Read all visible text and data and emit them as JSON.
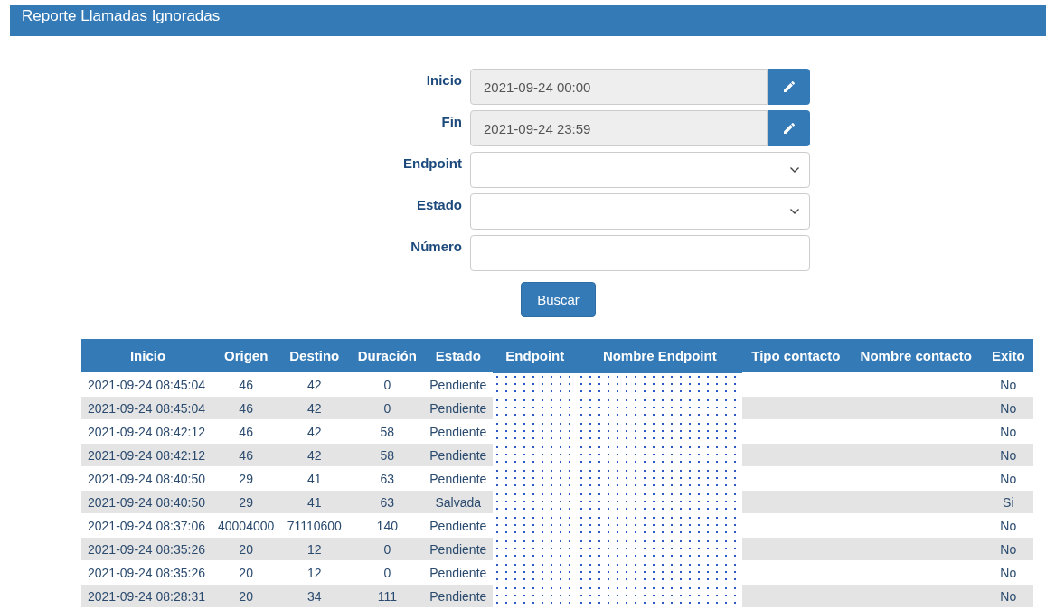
{
  "header": {
    "title": "Reporte Llamadas Ignoradas"
  },
  "form": {
    "fields": [
      {
        "label": "Inicio",
        "kind": "date",
        "value": "2021-09-24 00:00"
      },
      {
        "label": "Fin",
        "kind": "date",
        "value": "2021-09-24 23:59"
      },
      {
        "label": "Endpoint",
        "kind": "select"
      },
      {
        "label": "Estado",
        "kind": "select"
      },
      {
        "label": "Número",
        "kind": "text"
      }
    ],
    "button": "Buscar"
  },
  "table": {
    "columns": [
      {
        "label": "Inicio",
        "kind": "data"
      },
      {
        "label": "Origen",
        "kind": "data"
      },
      {
        "label": "Destino",
        "kind": "data"
      },
      {
        "label": "Duración",
        "kind": "data"
      },
      {
        "label": "Estado",
        "kind": "data"
      },
      {
        "label": "Endpoint",
        "kind": "redacted"
      },
      {
        "label": "Nombre Endpoint",
        "kind": "redacted"
      },
      {
        "label": "Tipo contacto",
        "kind": "blank"
      },
      {
        "label": "Nombre contacto",
        "kind": "blank"
      },
      {
        "label": "Exito",
        "kind": "data"
      }
    ],
    "rows": [
      [
        "2021-09-24 08:45:04",
        "46",
        "42",
        "0",
        "Pendiente",
        "No"
      ],
      [
        "2021-09-24 08:45:04",
        "46",
        "42",
        "0",
        "Pendiente",
        "No"
      ],
      [
        "2021-09-24 08:42:12",
        "46",
        "42",
        "58",
        "Pendiente",
        "No"
      ],
      [
        "2021-09-24 08:42:12",
        "46",
        "42",
        "58",
        "Pendiente",
        "No"
      ],
      [
        "2021-09-24 08:40:50",
        "29",
        "41",
        "63",
        "Pendiente",
        "No"
      ],
      [
        "2021-09-24 08:40:50",
        "29",
        "41",
        "63",
        "Salvada",
        "Si"
      ],
      [
        "2021-09-24 08:37:06",
        "40004000",
        "71110600",
        "140",
        "Pendiente",
        "No"
      ],
      [
        "2021-09-24 08:35:26",
        "20",
        "12",
        "0",
        "Pendiente",
        "No"
      ],
      [
        "2021-09-24 08:35:26",
        "20",
        "12",
        "0",
        "Pendiente",
        "No"
      ],
      [
        "2021-09-24 08:28:31",
        "20",
        "34",
        "111",
        "Pendiente",
        "No"
      ]
    ]
  }
}
